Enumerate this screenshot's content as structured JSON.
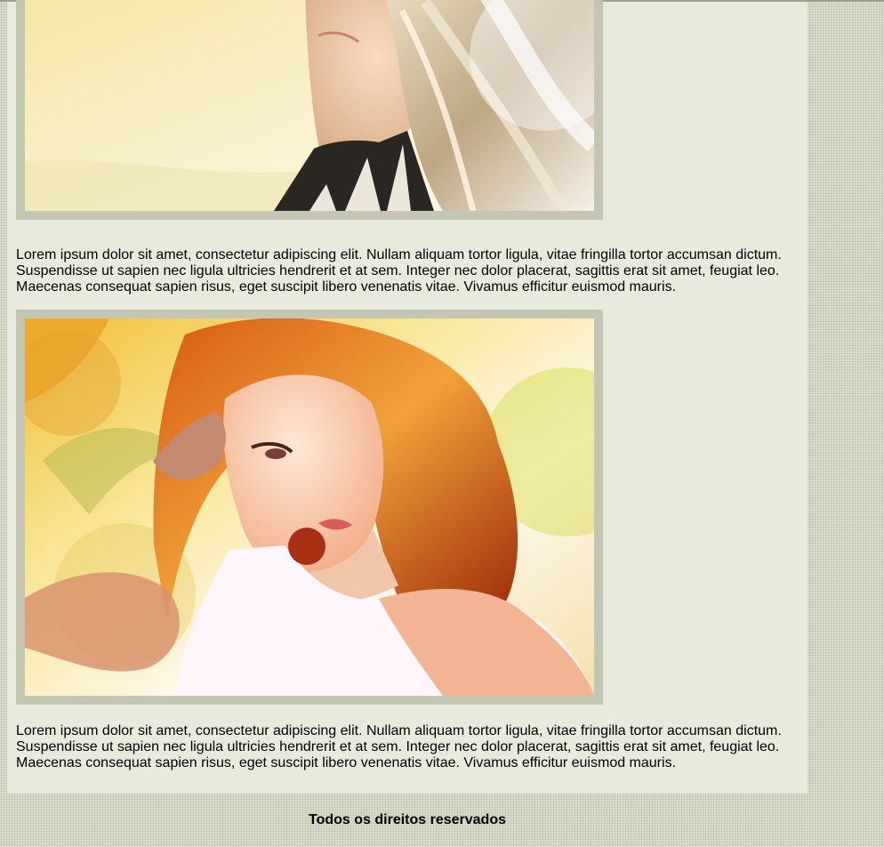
{
  "content": {
    "paragraphs": [
      "Lorem ipsum dolor sit amet, consectetur adipiscing elit. Nullam aliquam tortor ligula, vitae fringilla tortor accumsan dictum. Suspendisse ut sapien nec ligula ultricies hendrerit et at sem. Integer nec dolor placerat, sagittis erat sit amet, feugiat leo. Maecenas consequat sapien risus, eget suscipit libero venenatis vitae. Vivamus efficitur euismod mauris.",
      "Lorem ipsum dolor sit amet, consectetur adipiscing elit. Nullam aliquam tortor ligula, vitae fringilla tortor accumsan dictum. Suspendisse ut sapien nec ligula ultricies hendrerit et at sem. Integer nec dolor placerat, sagittis erat sit amet, feugiat leo. Maecenas consequat sapien risus, eget suscipit libero venenatis vitae. Vivamus efficitur euismod mauris."
    ]
  },
  "footer": {
    "text": "Todos os direitos reservados"
  },
  "colors": {
    "page_background": "#d6dac7",
    "content_background": "#e8ebdb",
    "image_frame": "#c2c6b2"
  }
}
